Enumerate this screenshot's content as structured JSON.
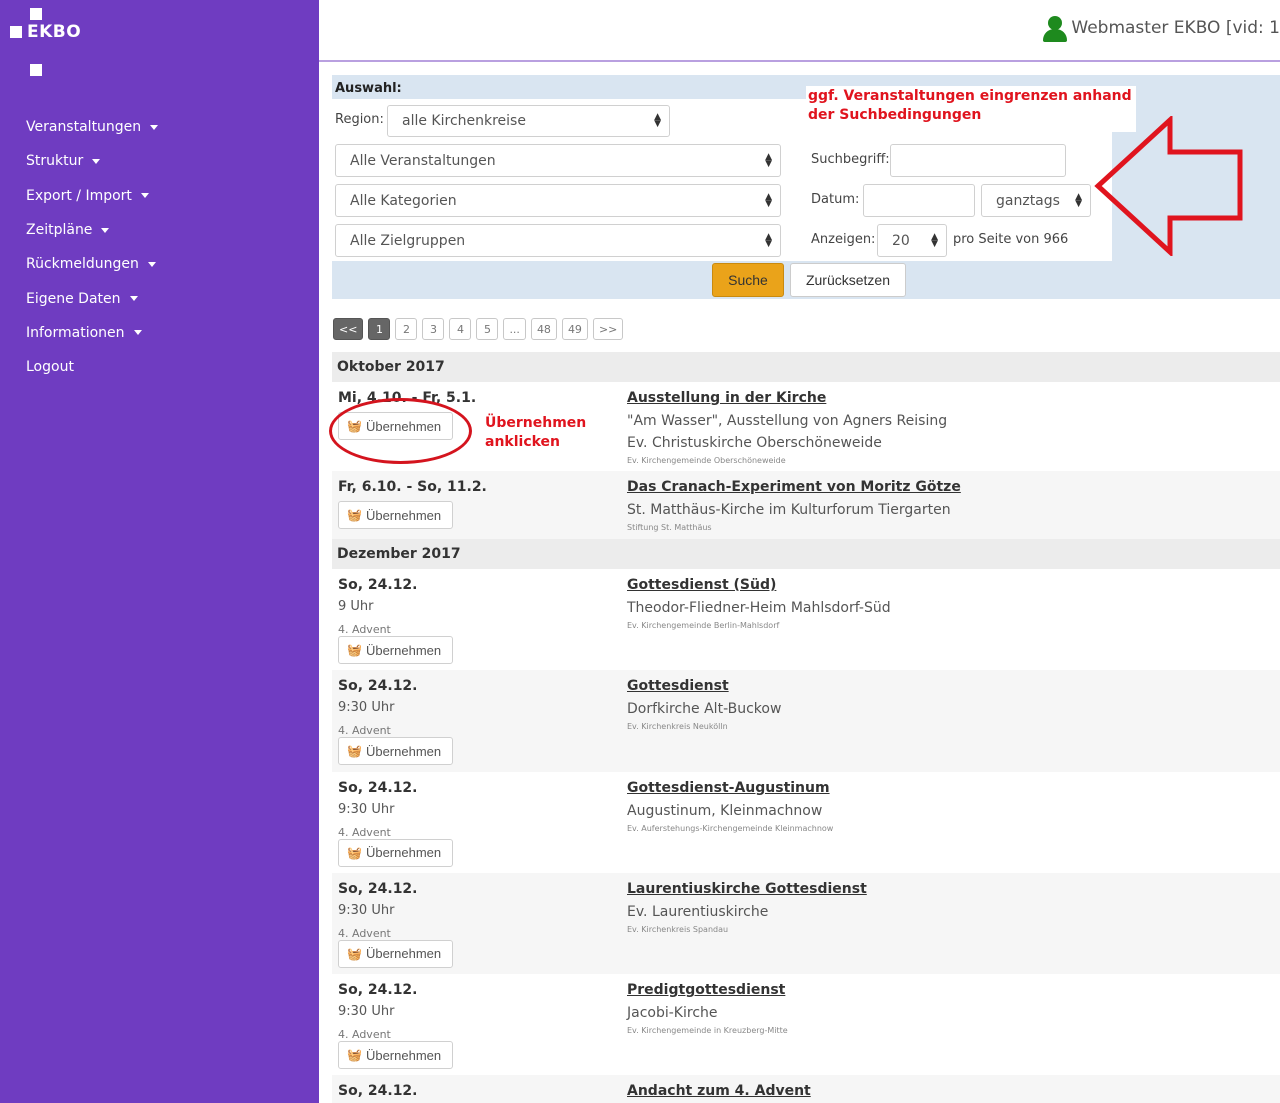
{
  "app": {
    "name": "EKBO"
  },
  "user": {
    "label": "Webmaster EKBO [vid: 1"
  },
  "nav": [
    {
      "label": "Veranstaltungen",
      "caret": true
    },
    {
      "label": "Struktur",
      "caret": true
    },
    {
      "label": "Export / Import",
      "caret": true
    },
    {
      "label": "Zeitpläne",
      "caret": true
    },
    {
      "label": "Rückmeldungen",
      "caret": true
    },
    {
      "label": "Eigene Daten",
      "caret": true
    },
    {
      "label": "Informationen",
      "caret": true
    },
    {
      "label": "Logout",
      "caret": false
    }
  ],
  "filter": {
    "title": "Auswahl:",
    "region_label": "Region:",
    "region_value": "alle Kirchenkreise",
    "events_value": "Alle Veranstaltungen",
    "categories_value": "Alle Kategorien",
    "targets_value": "Alle Zielgruppen",
    "search_label": "Suchbegriff:",
    "search_value": "",
    "date_label": "Datum:",
    "date_value": "",
    "time_value": "ganztags",
    "show_label": "Anzeigen:",
    "show_value": "20",
    "per_page_text": "pro Seite von 966",
    "search_button": "Suche",
    "reset_button": "Zurücksetzen"
  },
  "pagination": [
    "<<",
    "1",
    "2",
    "3",
    "4",
    "5",
    "...",
    "48",
    "49",
    ">>"
  ],
  "pagination_active": "1",
  "annotations": {
    "filter_hint": "ggf. Veranstaltungen eingrenzen anhand der Suchbedingungen",
    "take_over_hint": "Übernehmen anklicken",
    "arrow_color": "#e0141e"
  },
  "take_over_label": "Übernehmen",
  "months": [
    {
      "label": "Oktober 2017",
      "events": [
        {
          "date": "Mi, 4.10. - Fr, 5.1.",
          "time": "",
          "occasion": "",
          "title": "Ausstellung in der Kirche",
          "subtitle": "\"Am Wasser\", Ausstellung von Agners Reising",
          "location": "Ev. Christuskirche Oberschöneweide",
          "org": "Ev. Kirchengemeinde Oberschöneweide"
        },
        {
          "date": "Fr, 6.10. - So, 11.2.",
          "time": "",
          "occasion": "",
          "title": "Das Cranach-Experiment von Moritz Götze",
          "subtitle": "",
          "location": "St. Matthäus-Kirche im Kulturforum Tiergarten",
          "org": "Stiftung St. Matthäus"
        }
      ]
    },
    {
      "label": "Dezember 2017",
      "events": [
        {
          "date": "So, 24.12.",
          "time": "9 Uhr",
          "occasion": "4. Advent",
          "title": "Gottesdienst (Süd)",
          "subtitle": "",
          "location": "Theodor-Fliedner-Heim Mahlsdorf-Süd",
          "org": "Ev. Kirchengemeinde Berlin-Mahlsdorf"
        },
        {
          "date": "So, 24.12.",
          "time": "9:30 Uhr",
          "occasion": "4. Advent",
          "title": "Gottesdienst",
          "subtitle": "",
          "location": "Dorfkirche Alt-Buckow",
          "org": "Ev. Kirchenkreis Neukölln"
        },
        {
          "date": "So, 24.12.",
          "time": "9:30 Uhr",
          "occasion": "4. Advent",
          "title": "Gottesdienst-Augustinum",
          "subtitle": "",
          "location": "Augustinum, Kleinmachnow",
          "org": "Ev. Auferstehungs-Kirchengemeinde Kleinmachnow"
        },
        {
          "date": "So, 24.12.",
          "time": "9:30 Uhr",
          "occasion": "4. Advent",
          "title": "Laurentiuskirche Gottesdienst",
          "subtitle": "",
          "location": "Ev. Laurentiuskirche",
          "org": "Ev. Kirchenkreis Spandau"
        },
        {
          "date": "So, 24.12.",
          "time": "9:30 Uhr",
          "occasion": "4. Advent",
          "title": "Predigtgottesdienst",
          "subtitle": "",
          "location": "Jacobi-Kirche",
          "org": "Ev. Kirchengemeinde in Kreuzberg-Mitte"
        },
        {
          "date": "So, 24.12.",
          "time": "",
          "occasion": "",
          "title": "Andacht zum 4. Advent",
          "subtitle": "",
          "location": "",
          "org": ""
        }
      ]
    }
  ]
}
